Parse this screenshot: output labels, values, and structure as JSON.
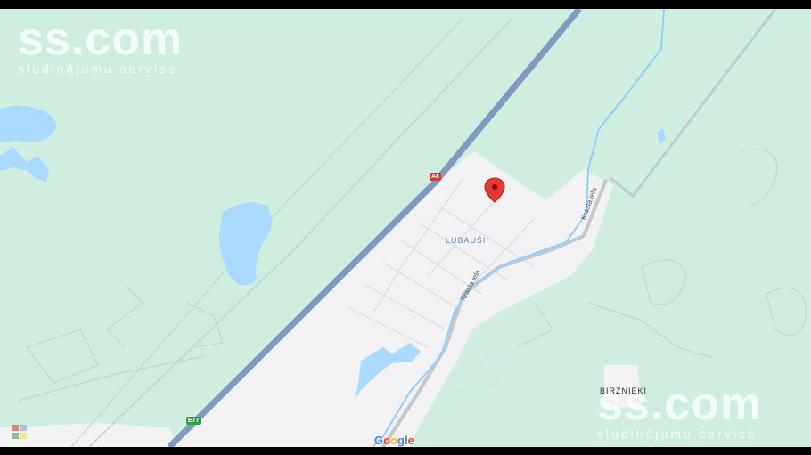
{
  "map": {
    "water_color": "#aadaff",
    "forest_color": "#cfeee0",
    "urban_color": "#f2f2f4",
    "motorway_color": "#7e9ac0",
    "marker_color": "#e53935"
  },
  "watermark": {
    "brand": "ss.com",
    "tagline": "sludinājumu serviss"
  },
  "labels": {
    "village_1": "LUBAUŠI",
    "village_2": "BIRZNIEKI",
    "street_1": "Krasta iela",
    "street_2": "Krasta iela"
  },
  "road_shields": {
    "a8": "A8",
    "e77": "E77"
  },
  "attribution": {
    "google": [
      "G",
      "o",
      "o",
      "g",
      "l",
      "e"
    ],
    "google_colors": [
      "#4285f4",
      "#ea4335",
      "#fbbc05",
      "#4285f4",
      "#34a853",
      "#ea4335"
    ]
  },
  "marker": {
    "icon": "location-pin-icon"
  }
}
